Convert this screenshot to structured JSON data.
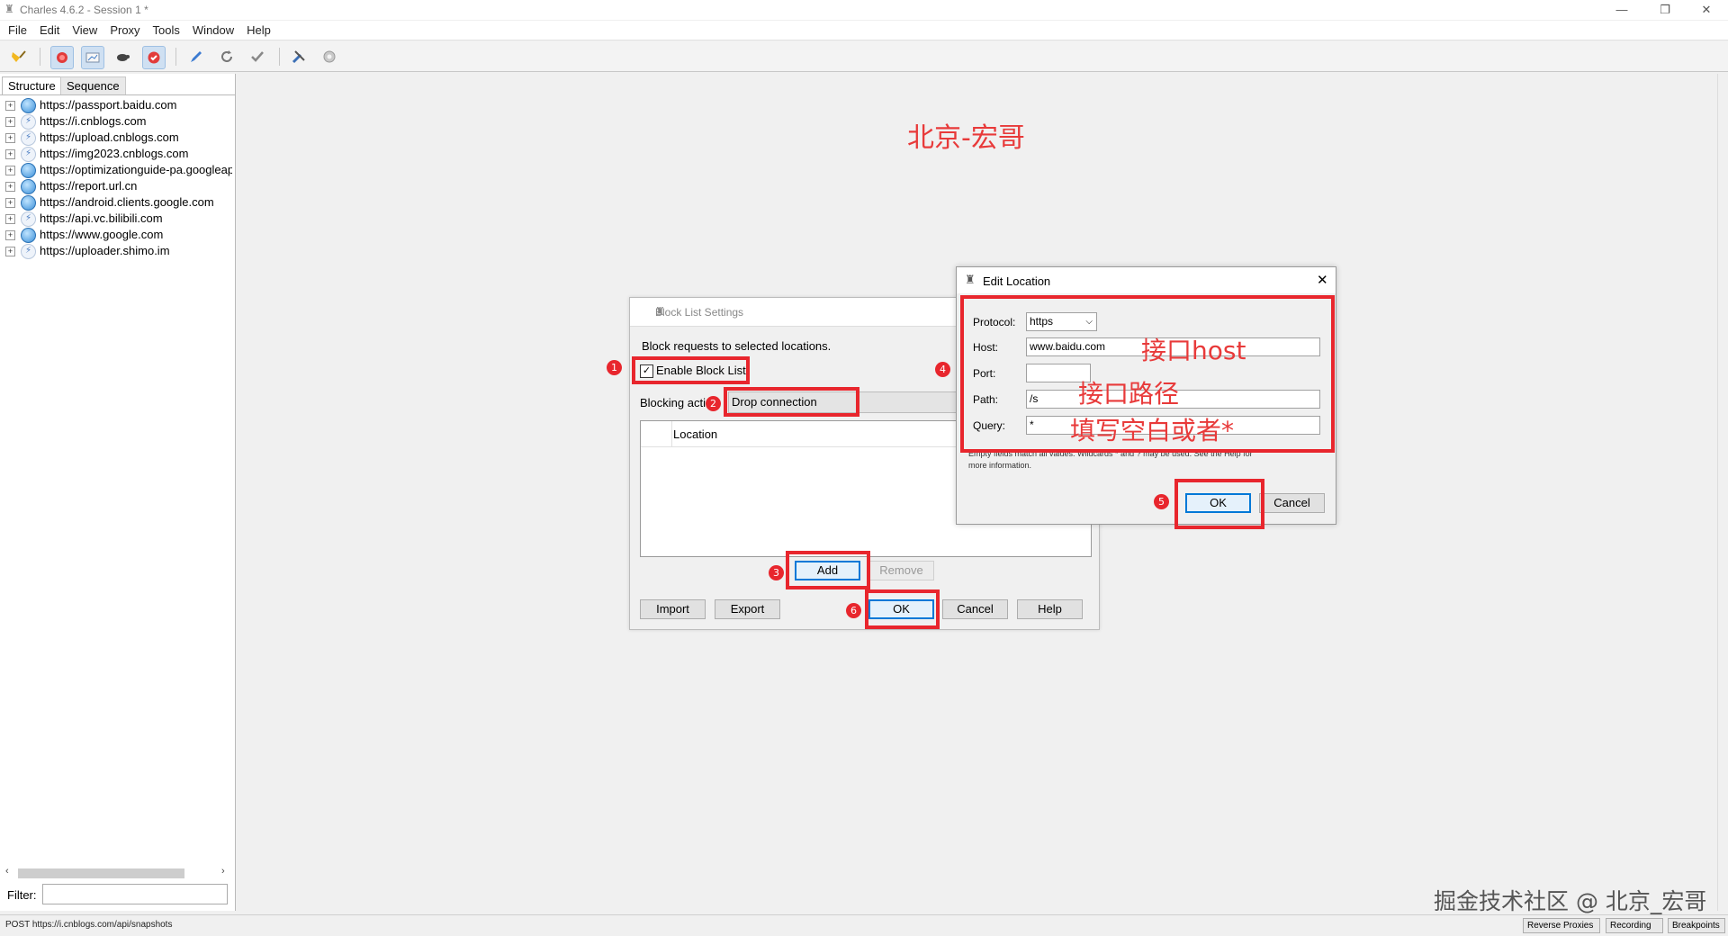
{
  "window": {
    "title": "Charles 4.6.2 - Session 1 *",
    "min": "—",
    "restore": "❐",
    "close": "✕"
  },
  "menu": [
    "File",
    "Edit",
    "View",
    "Proxy",
    "Tools",
    "Window",
    "Help"
  ],
  "left_panel": {
    "tabs": [
      "Structure",
      "Sequence"
    ],
    "items": [
      {
        "url": "https://passport.baidu.com",
        "icon": "globe"
      },
      {
        "url": "https://i.cnblogs.com",
        "icon": "bolt"
      },
      {
        "url": "https://upload.cnblogs.com",
        "icon": "bolt"
      },
      {
        "url": "https://img2023.cnblogs.com",
        "icon": "bolt"
      },
      {
        "url": "https://optimizationguide-pa.googleapis.com",
        "icon": "globe"
      },
      {
        "url": "https://report.url.cn",
        "icon": "globe"
      },
      {
        "url": "https://android.clients.google.com",
        "icon": "globe"
      },
      {
        "url": "https://api.vc.bilibili.com",
        "icon": "bolt"
      },
      {
        "url": "https://www.google.com",
        "icon": "globe"
      },
      {
        "url": "https://uploader.shimo.im",
        "icon": "bolt"
      }
    ],
    "filter_label": "Filter:"
  },
  "watermark_top": "北京-宏哥",
  "block_list": {
    "title": "Block List Settings",
    "description": "Block requests to selected locations.",
    "enable_label": "Enable Block List",
    "action_label": "Blocking acti",
    "action_value": "Drop connection",
    "column_location": "Location",
    "add": "Add",
    "remove": "Remove",
    "import": "Import",
    "export": "Export",
    "ok": "OK",
    "cancel": "Cancel",
    "help": "Help"
  },
  "edit_location": {
    "title": "Edit Location",
    "protocol_label": "Protocol:",
    "protocol_value": "https",
    "host_label": "Host:",
    "host_value": "www.baidu.com",
    "port_label": "Port:",
    "port_value": "",
    "path_label": "Path:",
    "path_value": "/s",
    "query_label": "Query:",
    "query_value": "*",
    "help_line1": "Empty fields match all values. Wildcards * and ? may be used. See the Help for",
    "help_line2": "more information.",
    "ok": "OK",
    "cancel": "Cancel"
  },
  "annotations": {
    "badges": [
      "1",
      "2",
      "3",
      "4",
      "5",
      "6"
    ],
    "host_note": "接口host",
    "path_note": "接口路径",
    "query_note": "填写空白或者*"
  },
  "status": {
    "text": "POST https://i.cnblogs.com/api/snapshots",
    "buttons": [
      "Reverse Proxies",
      "Recording",
      "Breakpoints"
    ]
  },
  "watermark_bottom": "掘金技术社区 @ 北京_宏哥",
  "colors": {
    "annotation_red": "#e8262d",
    "default_button_border": "#0078d7"
  }
}
